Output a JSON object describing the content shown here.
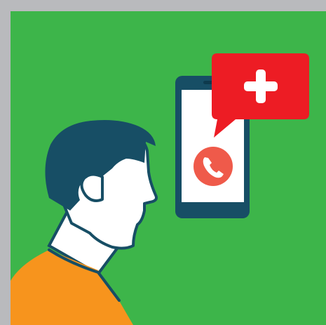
{
  "illustration": {
    "subject": "person-viewing-phone-medical-call",
    "colors": {
      "border": "#b9babd",
      "background": "#3db54a",
      "phone_body": "#174e65",
      "phone_screen": "#ffffff",
      "call_button": "#ef5a4a",
      "alert_bubble": "#ed1c24",
      "cross": "#ffffff",
      "hair": "#174e65",
      "skin": "#ffffff",
      "outline": "#174e65",
      "shirt": "#f7941d"
    },
    "icons": [
      "phone-handset-icon",
      "medical-cross-icon"
    ]
  }
}
